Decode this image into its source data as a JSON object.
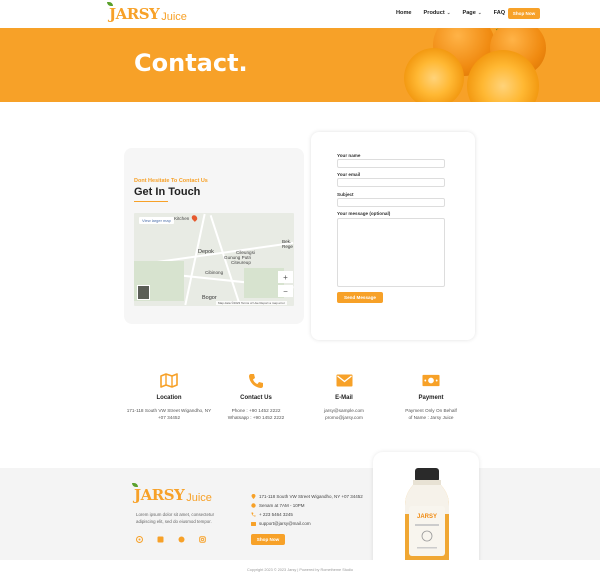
{
  "brand": {
    "logo_main": "JARSY",
    "logo_sub": "Juice"
  },
  "nav": {
    "items": [
      {
        "label": "Home",
        "caret": false
      },
      {
        "label": "Product",
        "caret": true
      },
      {
        "label": "Page",
        "caret": true
      },
      {
        "label": "FAQ",
        "caret": false
      }
    ],
    "shop_label": "Shop Now"
  },
  "hero": {
    "title": "Contact."
  },
  "info": {
    "subtitle": "Dont Hesitate To Contact Us",
    "title": "Get In Touch",
    "map": {
      "view_larger": "View larger map",
      "labels": [
        "Depok",
        "Bogor",
        "Cibinong",
        "Cileungsi",
        "Bek. Rege",
        "Gunung Putri",
        "Citeureup",
        "Kitchen"
      ],
      "zoom_in": "+",
      "zoom_out": "−",
      "footer": "Map data ©2023  Terms of Use  Report a map error"
    }
  },
  "form": {
    "name_label": "Your name",
    "email_label": "Your email",
    "subject_label": "Subject",
    "message_label": "Your message (optional)",
    "submit_label": "Send Message"
  },
  "features": [
    {
      "icon": "map-icon",
      "title": "Location",
      "lines": [
        "171-118 South VW Street Wigandho, NY",
        "+07 34452"
      ]
    },
    {
      "icon": "phone-icon",
      "title": "Contact Us",
      "lines": [
        "Phone : +90 1452 2222",
        "Whatsapp : +90 1452 2222"
      ]
    },
    {
      "icon": "mail-icon",
      "title": "E-Mail",
      "lines": [
        "jarsy@sample.com",
        "promo@jarsy.com"
      ]
    },
    {
      "icon": "money-icon",
      "title": "Payment",
      "lines": [
        "Payment Only On Behalf",
        "of Name : Jarsy Juice"
      ]
    }
  ],
  "footer": {
    "description": "Lorem ipsum dolor sit amet, consectetur adipiscing elit, sed do eiusmod tempor.",
    "address": "171-118 South VW Street Wigandho, NY +07 34452",
    "hours": "Senam at 7AM - 10PM",
    "phone": "+ 223 5464 3245",
    "email": "support@jarsy@mail.com",
    "shop_label": "Shop Now",
    "copyright": "Copyright 2023 © 2023 Jarsy | Powered by Rometheme Studio",
    "bottle_label": "JARSY"
  },
  "colors": {
    "accent": "#f7a128",
    "footer_bg": "#f4f4f4"
  }
}
